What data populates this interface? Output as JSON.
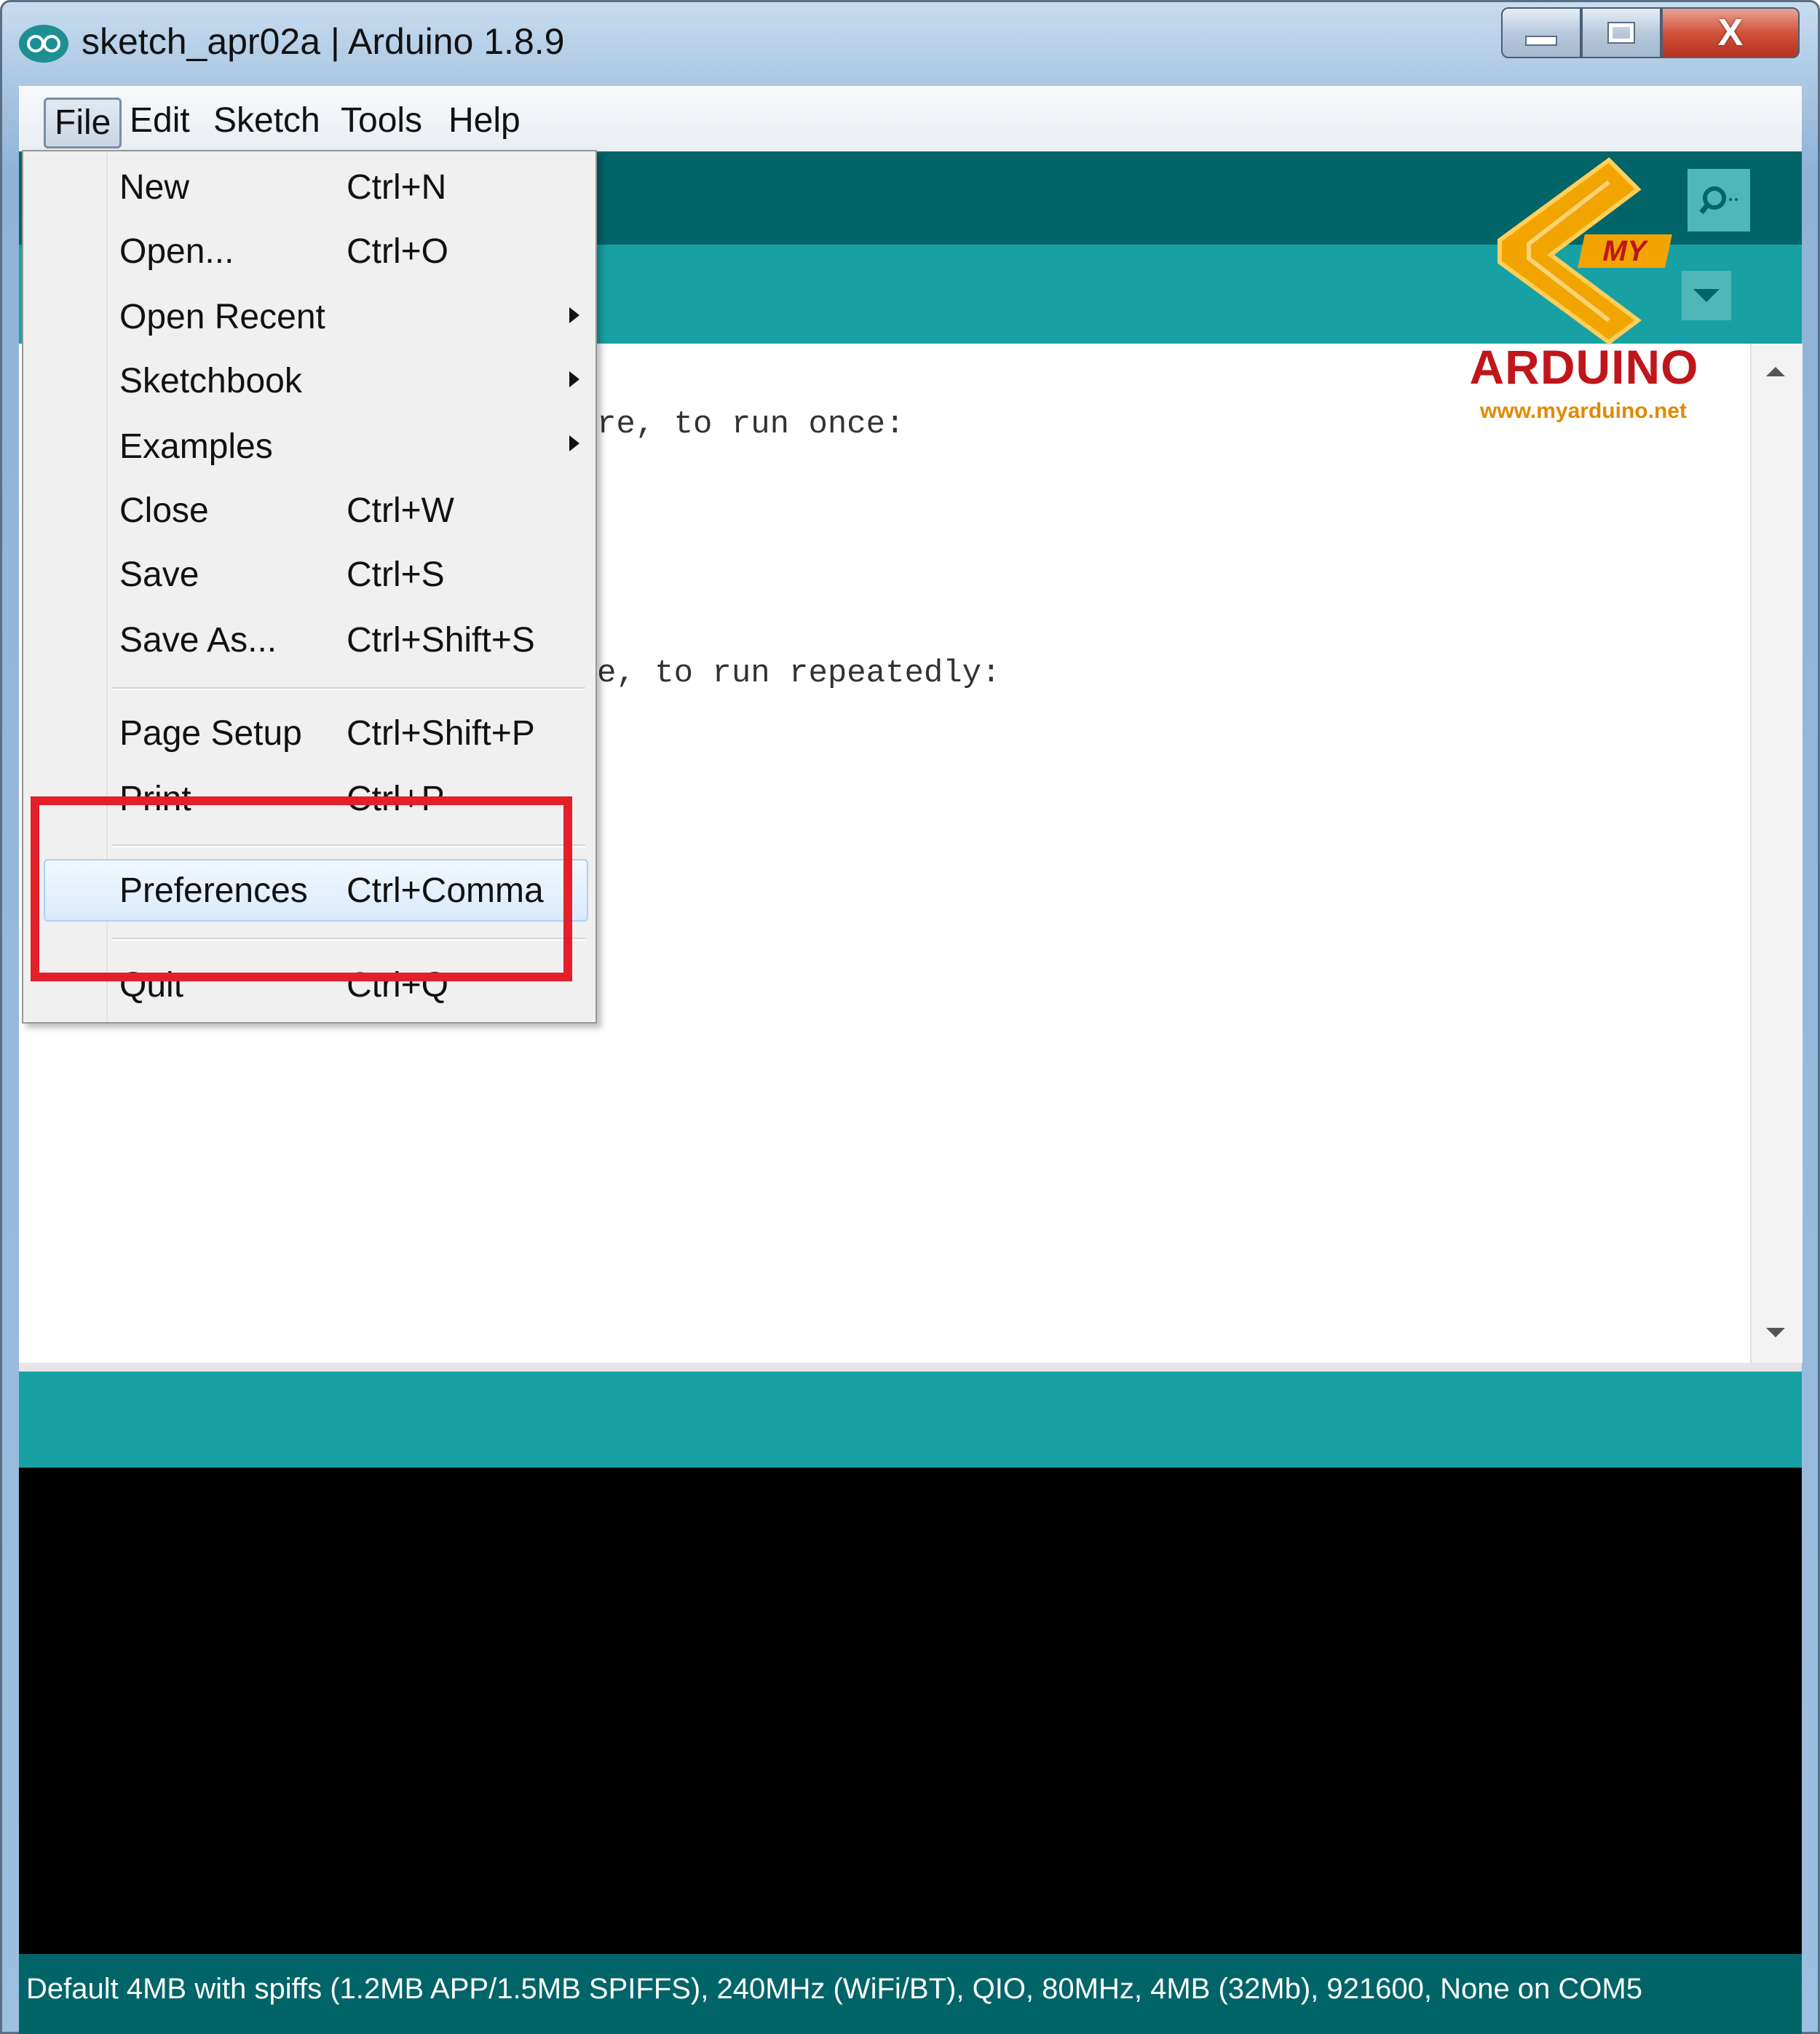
{
  "window": {
    "title": "sketch_apr02a | Arduino 1.8.9",
    "icon": "arduino-infinity-icon",
    "controls": {
      "minimize": "minimize-icon",
      "maximize": "maximize-icon",
      "close": "X"
    }
  },
  "menubar": {
    "items": [
      "File",
      "Edit",
      "Sketch",
      "Tools",
      "Help"
    ],
    "active": "File"
  },
  "file_menu": {
    "items": [
      {
        "label": "New",
        "shortcut": "Ctrl+N"
      },
      {
        "label": "Open...",
        "shortcut": "Ctrl+O"
      },
      {
        "label": "Open Recent",
        "submenu": true
      },
      {
        "label": "Sketchbook",
        "submenu": true
      },
      {
        "label": "Examples",
        "submenu": true
      },
      {
        "label": "Close",
        "shortcut": "Ctrl+W"
      },
      {
        "label": "Save",
        "shortcut": "Ctrl+S"
      },
      {
        "label": "Save As...",
        "shortcut": "Ctrl+Shift+S"
      },
      {
        "label": "Page Setup",
        "shortcut": "Ctrl+Shift+P"
      },
      {
        "label": "Print",
        "shortcut": "Ctrl+P"
      },
      {
        "label": "Preferences",
        "shortcut": "Ctrl+Comma",
        "highlighted": true
      },
      {
        "label": "Quit",
        "shortcut": "Ctrl+Q"
      }
    ]
  },
  "editor": {
    "visible_code": [
      "re, to run once:",
      "e, to run repeatedly:"
    ]
  },
  "watermark": {
    "my": "MY",
    "brand": "ARDUINO",
    "url": "www.myarduino.net"
  },
  "toolbar": {
    "serial_monitor_icon": "serial-monitor-icon",
    "tab_menu_icon": "chevron-down-icon"
  },
  "status_bar": {
    "text": "Default 4MB with spiffs (1.2MB APP/1.5MB SPIFFS), 240MHz (WiFi/BT), QIO, 80MHz, 4MB (32Mb), 921600, None on COM5"
  },
  "colors": {
    "toolbar_dark": "#006468",
    "toolbar_teal": "#17a1a5",
    "console": "#000000",
    "annotation_red": "#e3202a"
  }
}
